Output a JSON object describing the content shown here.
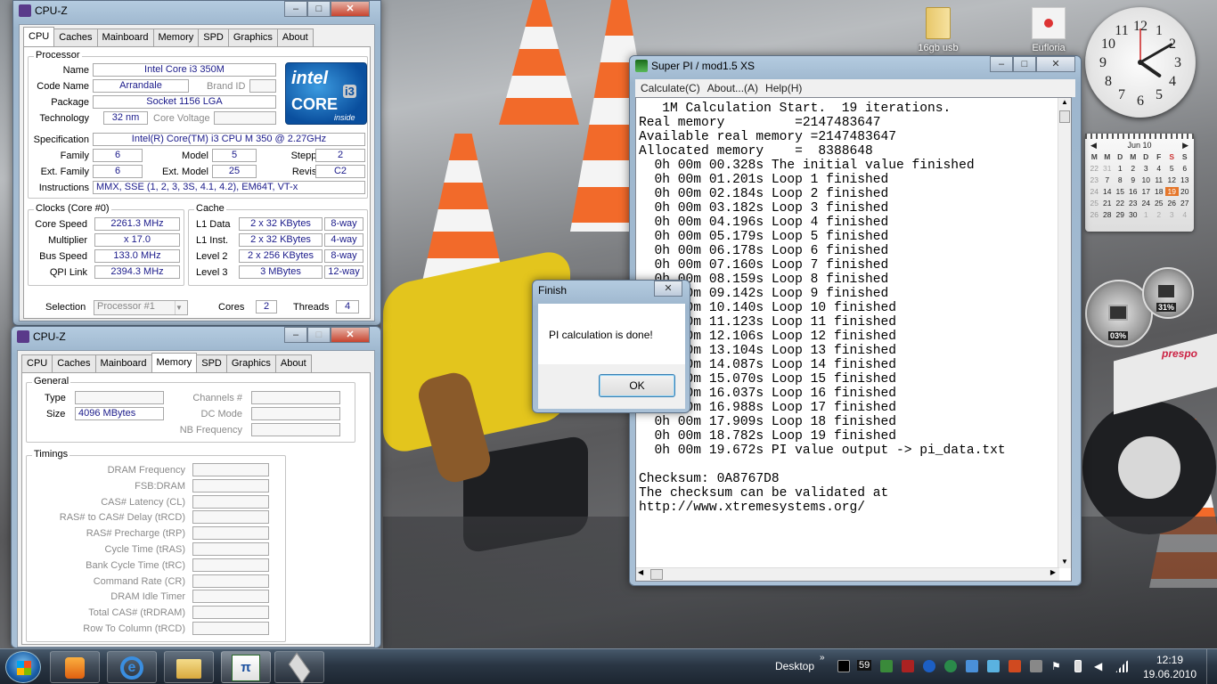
{
  "cpuz_top": {
    "title": "CPU-Z",
    "tabs": [
      "CPU",
      "Caches",
      "Mainboard",
      "Memory",
      "SPD",
      "Graphics",
      "About"
    ],
    "active_tab": "CPU",
    "processor": {
      "group": "Processor",
      "name_label": "Name",
      "name": "Intel Core i3 350M",
      "codename_label": "Code Name",
      "codename": "Arrandale",
      "brandid_label": "Brand ID",
      "package_label": "Package",
      "package": "Socket 1156 LGA",
      "technology_label": "Technology",
      "technology": "32 nm",
      "corevoltage_label": "Core Voltage",
      "spec_label": "Specification",
      "spec": "Intel(R) Core(TM) i3 CPU       M 350  @ 2.27GHz",
      "family_label": "Family",
      "family": "6",
      "model_label": "Model",
      "model": "5",
      "stepping_label": "Stepping",
      "stepping": "2",
      "extfamily_label": "Ext. Family",
      "extfamily": "6",
      "extmodel_label": "Ext. Model",
      "extmodel": "25",
      "revision_label": "Revision",
      "revision": "C2",
      "instructions_label": "Instructions",
      "instructions": "MMX, SSE (1, 2, 3, 3S, 4.1, 4.2), EM64T, VT-x",
      "logo_brand": "intel",
      "logo_core": "CORE",
      "logo_i3": "i3",
      "logo_inside": "inside"
    },
    "clocks": {
      "group": "Clocks (Core #0)",
      "core_speed_label": "Core Speed",
      "core_speed": "2261.3 MHz",
      "multiplier_label": "Multiplier",
      "multiplier": "x 17.0",
      "bus_speed_label": "Bus Speed",
      "bus_speed": "133.0 MHz",
      "qpi_label": "QPI Link",
      "qpi": "2394.3 MHz"
    },
    "cache": {
      "group": "Cache",
      "l1d_label": "L1 Data",
      "l1d": "2 x 32 KBytes",
      "l1d_way": "8-way",
      "l1i_label": "L1 Inst.",
      "l1i": "2 x 32 KBytes",
      "l1i_way": "4-way",
      "l2_label": "Level 2",
      "l2": "2 x 256 KBytes",
      "l2_way": "8-way",
      "l3_label": "Level 3",
      "l3": "3 MBytes",
      "l3_way": "12-way"
    },
    "selection_label": "Selection",
    "selection": "Processor #1",
    "cores_label": "Cores",
    "cores": "2",
    "threads_label": "Threads",
    "threads": "4"
  },
  "cpuz_bottom": {
    "title": "CPU-Z",
    "tabs": [
      "CPU",
      "Caches",
      "Mainboard",
      "Memory",
      "SPD",
      "Graphics",
      "About"
    ],
    "active_tab": "Memory",
    "general": {
      "group": "General",
      "type_label": "Type",
      "type": "",
      "size_label": "Size",
      "size": "4096 MBytes",
      "channels_label": "Channels #",
      "dcmode_label": "DC Mode",
      "nbfreq_label": "NB Frequency"
    },
    "timings": {
      "group": "Timings",
      "labels": [
        "DRAM Frequency",
        "FSB:DRAM",
        "CAS# Latency (CL)",
        "RAS# to CAS# Delay (tRCD)",
        "RAS# Precharge (tRP)",
        "Cycle Time (tRAS)",
        "Bank Cycle Time (tRC)",
        "Command Rate (CR)",
        "DRAM Idle Timer",
        "Total CAS# (tRDRAM)",
        "Row To Column (tRCD)"
      ]
    }
  },
  "superpi": {
    "title": "Super PI / mod1.5 XS",
    "menus": [
      "Calculate(C)",
      "About...(A)",
      "Help(H)"
    ],
    "lines": [
      "   1M Calculation Start.  19 iterations.",
      "Real memory         =2147483647",
      "Available real memory =2147483647",
      "Allocated memory    =  8388648",
      "  0h 00m 00.328s The initial value finished",
      "  0h 00m 01.201s Loop 1 finished",
      "  0h 00m 02.184s Loop 2 finished",
      "  0h 00m 03.182s Loop 3 finished",
      "  0h 00m 04.196s Loop 4 finished",
      "  0h 00m 05.179s Loop 5 finished",
      "  0h 00m 06.178s Loop 6 finished",
      "  0h 00m 07.160s Loop 7 finished",
      "  0h 00m 08.159s Loop 8 finished",
      "  0h 00m 09.142s Loop 9 finished",
      "  0h 00m 10.140s Loop 10 finished",
      "  0h 00m 11.123s Loop 11 finished",
      "  0h 00m 12.106s Loop 12 finished",
      "  0h 00m 13.104s Loop 13 finished",
      "  0h 00m 14.087s Loop 14 finished",
      "  0h 00m 15.070s Loop 15 finished",
      "  0h 00m 16.037s Loop 16 finished",
      "  0h 00m 16.988s Loop 17 finished",
      "  0h 00m 17.909s Loop 18 finished",
      "  0h 00m 18.782s Loop 19 finished",
      "  0h 00m 19.672s PI value output -> pi_data.txt",
      "",
      "Checksum: 0A8767D8",
      "The checksum can be validated at",
      "http://www.xtremesystems.org/"
    ]
  },
  "dialog": {
    "title": "Finish",
    "message": "PI calculation is done!",
    "ok": "OK"
  },
  "desktop_icons": [
    {
      "label": "16gb usb",
      "icon": "folder-icon"
    },
    {
      "label": "Eufloria",
      "icon": "eufloria-icon"
    }
  ],
  "calendar": {
    "month": "Jun 10",
    "weekdays": [
      "M",
      "M",
      "D",
      "M",
      "D",
      "F",
      "S",
      "S"
    ],
    "weeks": [
      [
        "22",
        "31",
        "1",
        "2",
        "3",
        "4",
        "5",
        "6"
      ],
      [
        "23",
        "7",
        "8",
        "9",
        "10",
        "11",
        "12",
        "13"
      ],
      [
        "24",
        "14",
        "15",
        "16",
        "17",
        "18",
        "19",
        "20"
      ],
      [
        "25",
        "21",
        "22",
        "23",
        "24",
        "25",
        "26",
        "27"
      ],
      [
        "26",
        "28",
        "29",
        "30",
        "1",
        "2",
        "3",
        "4"
      ]
    ],
    "today": "19"
  },
  "clock": {
    "hour": 4,
    "minute": 10
  },
  "meter": {
    "cpu": "03%",
    "mem": "31%",
    "brand": "prespo"
  },
  "taskbar": {
    "desktop_label": "Desktop",
    "tray_number": "59",
    "time": "12:19",
    "date": "19.06.2010",
    "apps": [
      "media-player-icon",
      "internet-explorer-icon",
      "explorer-icon",
      "superpi-icon",
      "cpuz-icon"
    ]
  }
}
